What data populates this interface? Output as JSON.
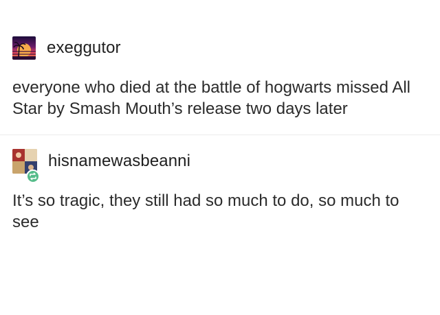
{
  "posts": [
    {
      "username": "exeggutor",
      "avatar_icon": "sunset-palm-avatar",
      "text": "everyone who died at the battle of hogwarts missed All Star by Smash Mouth’s release two days later"
    },
    {
      "username": "hisnamewasbeanni",
      "avatar_icon": "collage-avatar",
      "badge_icon": "reblog-icon",
      "badge_color": "#56bc8a",
      "text": "It’s so tragic, they still had so much to do, so much to see"
    }
  ]
}
